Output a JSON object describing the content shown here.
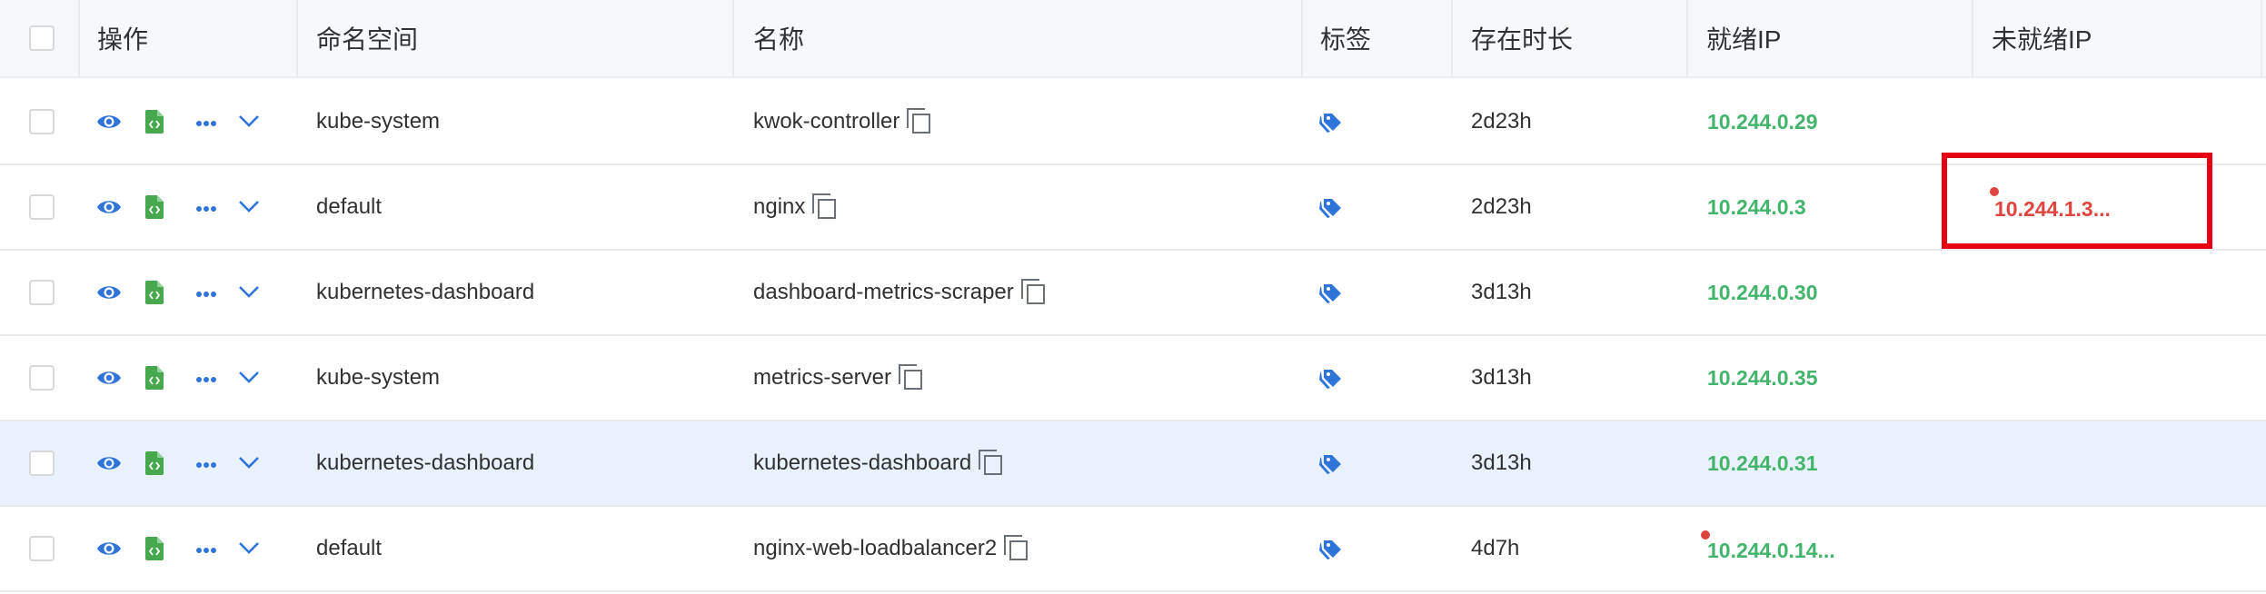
{
  "header": {
    "action": "操作",
    "namespace": "命名空间",
    "name": "名称",
    "labels": "标签",
    "age": "存在时长",
    "ready_ip": "就绪IP",
    "not_ready_ip": "未就绪IP"
  },
  "rows": [
    {
      "namespace": "kube-system",
      "name": "kwok-controller",
      "age": "2d23h",
      "ready_ip": "10.244.0.29",
      "not_ready_ip": ""
    },
    {
      "namespace": "default",
      "name": "nginx",
      "age": "2d23h",
      "ready_ip": "10.244.0.3",
      "not_ready_ip": "10.244.1.3..."
    },
    {
      "namespace": "kubernetes-dashboard",
      "name": "dashboard-metrics-scraper",
      "age": "3d13h",
      "ready_ip": "10.244.0.30",
      "not_ready_ip": ""
    },
    {
      "namespace": "kube-system",
      "name": "metrics-server",
      "age": "3d13h",
      "ready_ip": "10.244.0.35",
      "not_ready_ip": ""
    },
    {
      "namespace": "kubernetes-dashboard",
      "name": "kubernetes-dashboard",
      "age": "3d13h",
      "ready_ip": "10.244.0.31",
      "not_ready_ip": ""
    },
    {
      "namespace": "default",
      "name": "nginx-web-loadbalancer2",
      "age": "4d7h",
      "ready_ip": "10.244.0.14...",
      "not_ready_ip": ""
    }
  ],
  "colors": {
    "accent": "#2f74d8",
    "doc_icon": "#47a84d",
    "ready_ip": "#43b56b",
    "not_ready_ip": "#e0443e",
    "highlight_row": "#e9f1fd",
    "annotation_box": "#e60012"
  },
  "icons": {
    "view": "eye-icon",
    "yaml": "file-code-icon",
    "more": "more-dots-icon",
    "expand": "chevron-down-icon",
    "labels": "tag-icon",
    "copy": "copy-icon"
  }
}
